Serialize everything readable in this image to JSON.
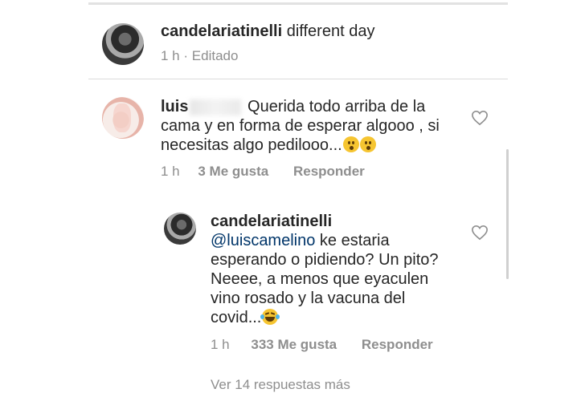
{
  "caption": {
    "username": "candelariatinelli",
    "text": "different day",
    "time": "1 h",
    "separator": "·",
    "edited": "Editado"
  },
  "comment": {
    "username_visible": "luis",
    "line1": "Querida todo arriba de la",
    "line2": "cama y en forma de esperar algooo , si",
    "line3": "necesitas algo pedilooo...",
    "time": "1 h",
    "likes": "3 Me gusta",
    "reply": "Responder"
  },
  "reply": {
    "username": "candelariatinelli",
    "mention": "@luiscamelino",
    "line1_rest": " ke estaria",
    "line2": "esperando o pidiendo? Un pito?",
    "line3": "Neeee, a menos que eyaculen",
    "line4": "vino rosado y la vacuna del",
    "line5": "covid...",
    "time": "1 h",
    "likes": "333 Me gusta",
    "reply": "Responder"
  },
  "view_more": "Ver 14 respuestas más",
  "icons": {
    "heart": "heart-icon",
    "emoji_wow": "astonished-face-icon",
    "emoji_laugh": "grinning-squinting-face-icon"
  },
  "colors": {
    "text": "#262626",
    "muted": "#8e8e8e",
    "mention": "#003569"
  }
}
